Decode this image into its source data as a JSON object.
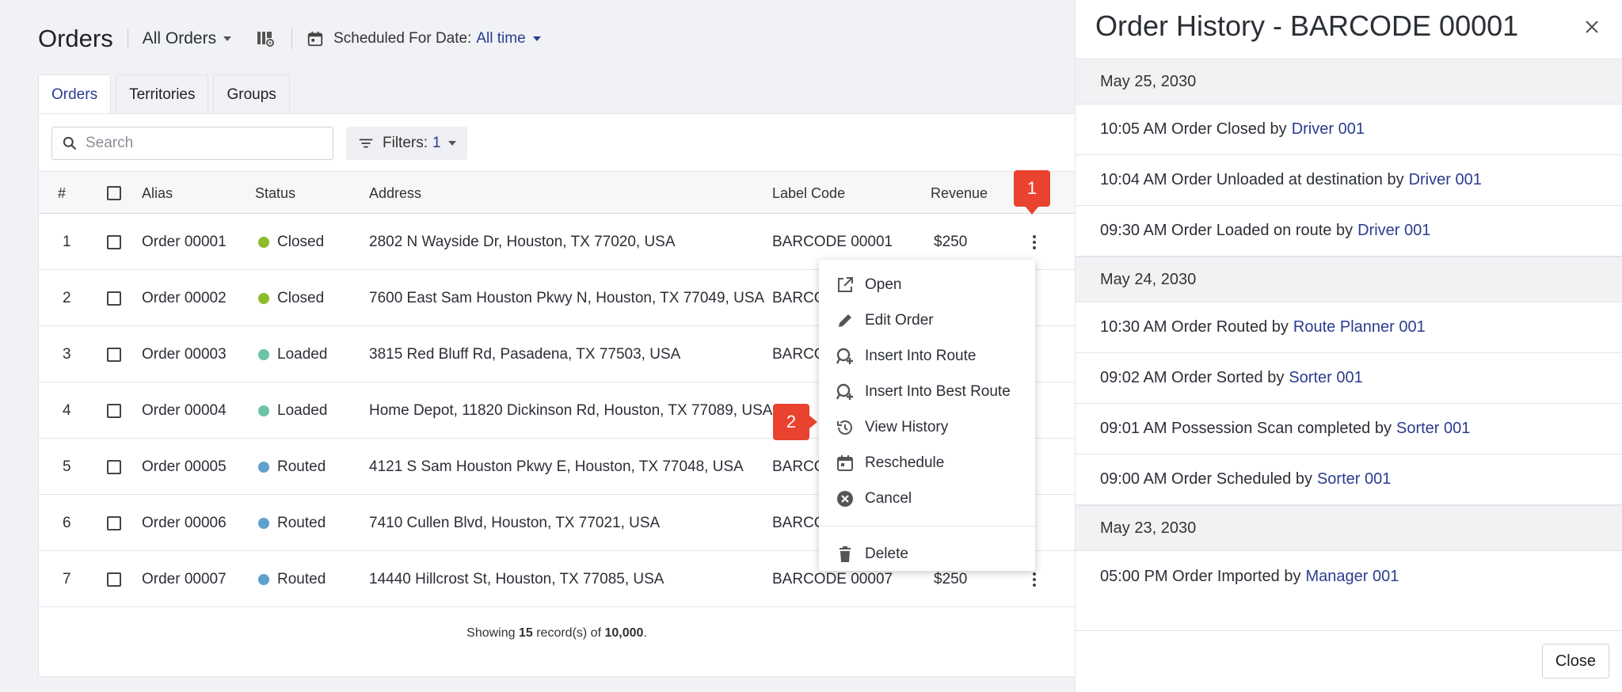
{
  "header": {
    "title": "Orders",
    "view_select": "All Orders",
    "date_filter_label": "Scheduled For Date:",
    "date_filter_value": "All time"
  },
  "tabs": [
    {
      "label": "Orders",
      "active": true
    },
    {
      "label": "Territories",
      "active": false
    },
    {
      "label": "Groups",
      "active": false
    }
  ],
  "toolbar": {
    "search_placeholder": "Search",
    "filters_label": "Filters:",
    "filters_count": "1"
  },
  "table": {
    "columns": [
      "#",
      "Alias",
      "Status",
      "Address",
      "Label Code",
      "Revenue"
    ],
    "rows": [
      {
        "num": "1",
        "alias": "Order 00001",
        "status": "Closed",
        "address": "2802 N Wayside Dr, Houston, TX 77020, USA",
        "label": "BARCODE 00001",
        "revenue": "$250"
      },
      {
        "num": "2",
        "alias": "Order 00002",
        "status": "Closed",
        "address": "7600 East Sam Houston Pkwy N, Houston, TX 77049, USA",
        "label": "BARCO",
        "revenue": ""
      },
      {
        "num": "3",
        "alias": "Order 00003",
        "status": "Loaded",
        "address": "3815 Red Bluff Rd, Pasadena, TX 77503, USA",
        "label": "BARCO",
        "revenue": ""
      },
      {
        "num": "4",
        "alias": "Order 00004",
        "status": "Loaded",
        "address": "Home Depot, 11820 Dickinson Rd, Houston, TX 77089, USA",
        "label": "",
        "revenue": ""
      },
      {
        "num": "5",
        "alias": "Order 00005",
        "status": "Routed",
        "address": "4121 S Sam Houston Pkwy E, Houston, TX 77048, USA",
        "label": "BARCO",
        "revenue": ""
      },
      {
        "num": "6",
        "alias": "Order 00006",
        "status": "Routed",
        "address": "7410 Cullen Blvd, Houston, TX 77021, USA",
        "label": "BARCO",
        "revenue": ""
      },
      {
        "num": "7",
        "alias": "Order 00007",
        "status": "Routed",
        "address": "14440 Hillcrost St, Houston, TX 77085, USA",
        "label": "BARCODE 00007",
        "revenue": "$250"
      }
    ],
    "footer": {
      "prefix": "Showing",
      "shown": "15",
      "middle": "record(s) of",
      "total": "10,000",
      "suffix": "."
    }
  },
  "status_colors": {
    "Closed": "#8cbb2c",
    "Loaded": "#6dc4a4",
    "Routed": "#5fa0cf"
  },
  "context_menu": {
    "items": [
      {
        "label": "Open",
        "icon": "open-external-icon"
      },
      {
        "label": "Edit Order",
        "icon": "pencil-icon"
      },
      {
        "label": "Insert Into Route",
        "icon": "insert-route-icon"
      },
      {
        "label": "Insert Into Best Route",
        "icon": "insert-best-route-icon"
      },
      {
        "label": "View History",
        "icon": "history-icon"
      },
      {
        "label": "Reschedule",
        "icon": "calendar-icon"
      },
      {
        "label": "Cancel",
        "icon": "cancel-circle-icon"
      }
    ],
    "delete_label": "Delete"
  },
  "callouts": [
    "1",
    "2"
  ],
  "history_panel": {
    "title": "Order History - BARCODE 00001",
    "close_label": "Close",
    "groups": [
      {
        "date": "May 25, 2030",
        "entries": [
          {
            "text": "10:05 AM Order Closed by",
            "actor": "Driver 001"
          },
          {
            "text": "10:04 AM Order Unloaded at destination by",
            "actor": "Driver 001"
          },
          {
            "text": "09:30 AM Order Loaded on route by",
            "actor": "Driver 001"
          }
        ]
      },
      {
        "date": "May 24, 2030",
        "entries": [
          {
            "text": "10:30 AM Order Routed by",
            "actor": "Route Planner 001"
          },
          {
            "text": "09:02 AM Order Sorted by",
            "actor": "Sorter 001"
          },
          {
            "text": "09:01 AM Possession Scan completed by",
            "actor": "Sorter 001"
          },
          {
            "text": "09:00 AM Order Scheduled by",
            "actor": "Sorter 001"
          }
        ]
      },
      {
        "date": "May 23, 2030",
        "entries": [
          {
            "text": "05:00 PM Order Imported by",
            "actor": "Manager 001"
          }
        ]
      }
    ]
  }
}
